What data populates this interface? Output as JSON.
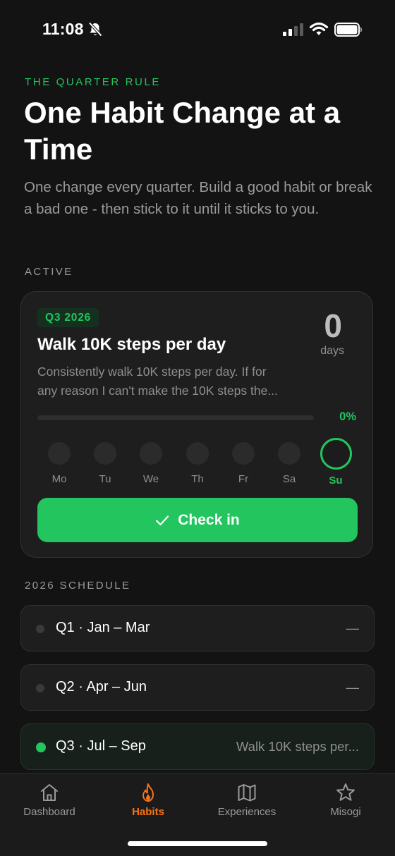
{
  "status_bar": {
    "time": "11:08",
    "icons": [
      "bell-muted-icon",
      "cellular-signal-icon",
      "wifi-icon",
      "battery-icon"
    ]
  },
  "header": {
    "eyebrow": "THE QUARTER RULE",
    "title": "One Habit Change at a Time",
    "subtitle": "One change every quarter. Build a good habit or break a bad one - then stick to it until it sticks to you."
  },
  "active": {
    "section_label": "ACTIVE",
    "badge": "Q3 2026",
    "title": "Walk 10K steps per day",
    "description_lines": [
      "Consistently walk 10K steps per day. If for",
      "any reason I can't make the 10K steps the..."
    ],
    "days_count": "0",
    "days_label": "days",
    "progress_percent_label": "0%",
    "progress_fraction": 0,
    "week": [
      {
        "label": "Mo",
        "today": false
      },
      {
        "label": "Tu",
        "today": false
      },
      {
        "label": "We",
        "today": false
      },
      {
        "label": "Th",
        "today": false
      },
      {
        "label": "Fr",
        "today": false
      },
      {
        "label": "Sa",
        "today": false
      },
      {
        "label": "Su",
        "today": true
      }
    ],
    "checkin_label": "Check in"
  },
  "schedule": {
    "section_label": "2026 SCHEDULE",
    "rows": [
      {
        "label": "Q1 · Jan – Mar",
        "value": "—",
        "current": false
      },
      {
        "label": "Q2 · Apr – Jun",
        "value": "—",
        "current": false
      },
      {
        "label": "Q3 · Jul – Sep",
        "value": "Walk 10K steps per...",
        "current": true
      }
    ]
  },
  "tab_bar": {
    "tabs": [
      {
        "label": "Dashboard",
        "icon": "home-icon",
        "active": false
      },
      {
        "label": "Habits",
        "icon": "flame-icon",
        "active": true
      },
      {
        "label": "Experiences",
        "icon": "map-icon",
        "active": false
      },
      {
        "label": "Misogi",
        "icon": "star-icon",
        "active": false
      }
    ]
  },
  "colors": {
    "background": "#131313",
    "card": "#1e1e1e",
    "accent_green": "#22c55e",
    "accent_orange": "#f97316",
    "muted_text": "#9a9a9a"
  }
}
